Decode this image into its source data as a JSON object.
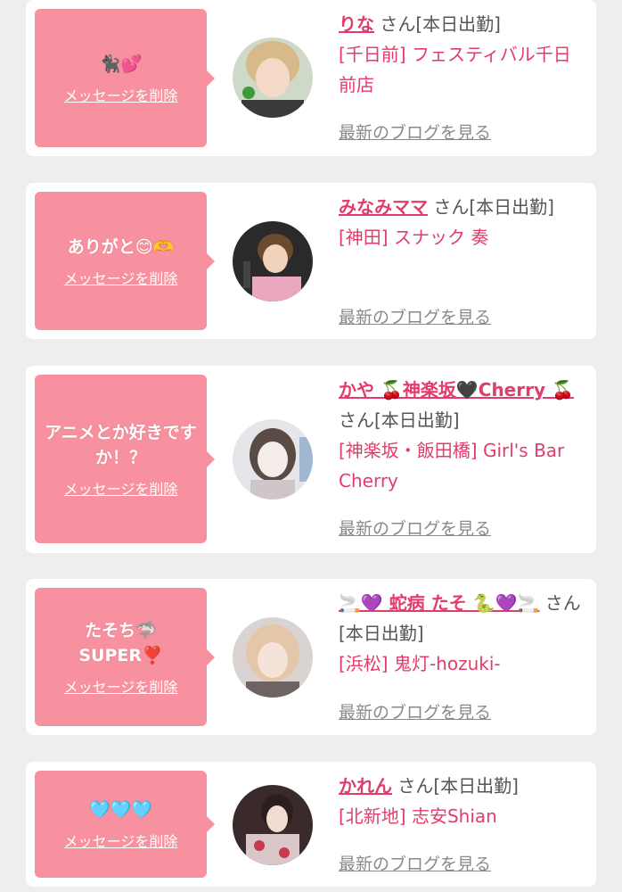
{
  "cards": [
    {
      "message": "🐈‍⬛💕",
      "delete_label": "メッセージを削除",
      "name": "りな",
      "suffix": "さん[本日出勤]",
      "shop": "[千日前] フェスティバル千日前店",
      "blog_label": "最新のブログを見る"
    },
    {
      "message": "ありがと😊🫶",
      "delete_label": "メッセージを削除",
      "name": "みなみママ",
      "suffix": "さん[本日出勤]",
      "shop": "[神田] スナック 奏",
      "blog_label": "最新のブログを見る"
    },
    {
      "message": "アニメとか好きですか！？",
      "delete_label": "メッセージを削除",
      "name": "かや 🍒神楽坂🖤Cherry 🍒",
      "suffix": "さん[本日出勤]",
      "shop": "[神楽坂・飯田橋] Girl's Bar Cherry",
      "blog_label": "最新のブログを見る"
    },
    {
      "message": "たそち🦈\nSUPER❣️",
      "delete_label": "メッセージを削除",
      "name": "🚬💜 蛇病 たそ 🐍💜🚬",
      "suffix": "さん[本日出勤]",
      "shop": "[浜松] 鬼灯-hozuki-",
      "blog_label": "最新のブログを見る"
    },
    {
      "message": "🩵🩵🩵",
      "delete_label": "メッセージを削除",
      "name": "かれん",
      "suffix": "さん[本日出勤]",
      "shop": "[北新地] 志安Shian",
      "blog_label": "最新のブログを見る"
    }
  ]
}
